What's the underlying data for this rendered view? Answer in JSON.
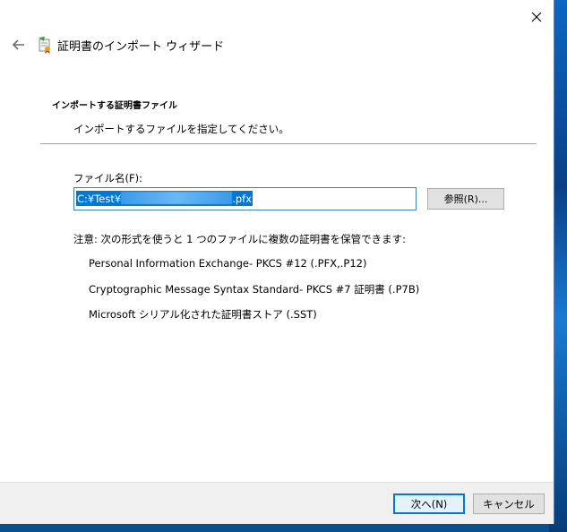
{
  "wizard": {
    "title": "証明書のインポート ウィザード"
  },
  "page": {
    "section_title": "インポートする証明書ファイル",
    "section_desc": "インポートするファイルを指定してください。"
  },
  "file": {
    "label": "ファイル名(F):",
    "value_prefix": "C:¥Test¥",
    "value_suffix": ".pfx",
    "browse_label": "参照(R)..."
  },
  "formats": {
    "note": "注意: 次の形式を使うと 1 つのファイルに複数の証明書を保管できます:",
    "items": [
      "Personal Information Exchange- PKCS #12 (.PFX,.P12)",
      "Cryptographic Message Syntax Standard- PKCS #7 証明書 (.P7B)",
      "Microsoft シリアル化された証明書ストア (.SST)"
    ]
  },
  "footer": {
    "next_label": "次へ(N)",
    "cancel_label": "キャンセル"
  },
  "icons": {
    "close": "close-icon",
    "back": "back-arrow-icon",
    "wizard": "certificate-wizard-icon"
  },
  "colors": {
    "accent": "#0078d7",
    "selection": "#0078d7"
  }
}
